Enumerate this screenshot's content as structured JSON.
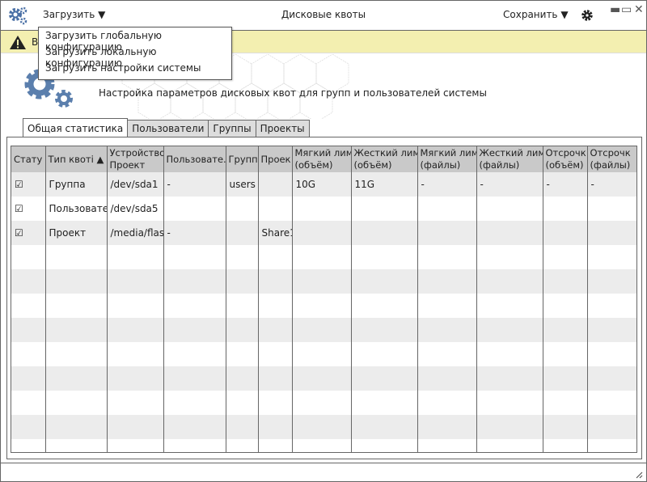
{
  "window": {
    "title": "Дисковые квоты",
    "minimize": "▬",
    "maximize": "▭",
    "close": "✕"
  },
  "toolbar": {
    "load_label": "Загрузить",
    "save_label": "Сохранить"
  },
  "load_menu": [
    "Загрузить глобальную конфигурацию",
    "Загрузить локальную конфигурацию",
    "Загрузить настройки системы"
  ],
  "warning": {
    "text": "В"
  },
  "header": {
    "subtitle": "Настройка параметров дисковых квот для групп и пользователей системы"
  },
  "tabs": [
    "Общая статистика",
    "Пользователи",
    "Группы",
    "Проекты"
  ],
  "table": {
    "columns": [
      "Стату",
      "Тип квоті ▲",
      "Устройство\nПроект",
      "Пользовате.",
      "Группі",
      "Проек",
      "Мягкий лимі\n(объём)",
      "Жесткий лим\n(объём)",
      "Мягкий лимі\n(файлы)",
      "Жесткий лим\n(файлы)",
      "Отсрочк\n(объём)",
      "Отсрочк\n(файлы)"
    ],
    "rows": [
      [
        "☑",
        "Группа",
        "/dev/sda1",
        "-",
        "users",
        "",
        "10G",
        "11G",
        "-",
        "-",
        "-",
        "-"
      ],
      [
        "☑",
        "Пользовате.",
        "/dev/sda5",
        "",
        "",
        "",
        "",
        "",
        "",
        "",
        "",
        ""
      ],
      [
        "☑",
        "Проект",
        "/media/flas",
        "-",
        "",
        "Share1",
        "",
        "",
        "",
        "",
        "",
        ""
      ]
    ]
  },
  "colors": {
    "accent": "#5b7fad",
    "warning_bg": "#f3efb0"
  }
}
